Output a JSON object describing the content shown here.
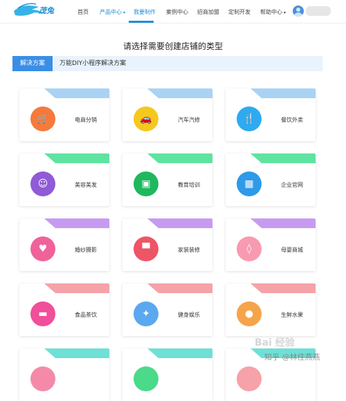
{
  "nav": {
    "logo_text": "茂兔",
    "items": [
      {
        "label": "首页"
      },
      {
        "label": "产品中心",
        "caret": "▾"
      },
      {
        "label": "我要制作"
      },
      {
        "label": "案例中心"
      },
      {
        "label": "招商加盟"
      },
      {
        "label": "定制开发"
      },
      {
        "label": "帮助中心",
        "caret": "▾"
      }
    ]
  },
  "page": {
    "title": "请选择需要创建店铺的类型",
    "tab_active": "解决方案",
    "tab_other": "万能DIY小程序解决方案"
  },
  "cards": [
    {
      "label": "电商分销",
      "icon": "shopping-cart-icon",
      "glyph": "🛒",
      "color": "#f57a3b",
      "ribbon": "#a9d2f5"
    },
    {
      "label": "汽车汽修",
      "icon": "car-icon",
      "glyph": "🚗",
      "color": "#f5c81e",
      "ribbon": "#a9d2f5"
    },
    {
      "label": "餐饮外卖",
      "icon": "fork-knife-icon",
      "glyph": "🍴",
      "color": "#2eaaf0",
      "ribbon": "#a9d2f5"
    },
    {
      "label": "美容美发",
      "icon": "beauty-face-icon",
      "glyph": "☺",
      "color": "#8f5bd6",
      "ribbon": "#5fe3a0"
    },
    {
      "label": "教育培训",
      "icon": "blackboard-icon",
      "glyph": "▣",
      "color": "#1fb85e",
      "ribbon": "#5fe3a0"
    },
    {
      "label": "企业官网",
      "icon": "building-icon",
      "glyph": "▦",
      "color": "#2e9ae8",
      "ribbon": "#5fe3a0"
    },
    {
      "label": "婚纱摄影",
      "icon": "wedding-couple-icon",
      "glyph": "♥",
      "color": "#f0629a",
      "ribbon": "#c79af2"
    },
    {
      "label": "家装装修",
      "icon": "paint-roller-icon",
      "glyph": "▀",
      "color": "#ee5566",
      "ribbon": "#c79af2"
    },
    {
      "label": "母婴商城",
      "icon": "baby-bottle-icon",
      "glyph": "◊",
      "color": "#f89ab0",
      "ribbon": "#c79af2"
    },
    {
      "label": "食品茶饮",
      "icon": "food-icon",
      "glyph": "▬",
      "color": "#f04f9a",
      "ribbon": "#f5a2a8"
    },
    {
      "label": "健身娱乐",
      "icon": "dumbbell-icon",
      "glyph": "✦",
      "color": "#5aa8f0",
      "ribbon": "#f5a2a8"
    },
    {
      "label": "生鲜水果",
      "icon": "fruit-icon",
      "glyph": "●",
      "color": "#f5a44a",
      "ribbon": "#f5a2a8"
    }
  ],
  "partial_cards": [
    {
      "ribbon": "#6fe0d6",
      "color": "#f58aa8"
    },
    {
      "ribbon": "#6fe0d6",
      "color": "#4bd98a"
    },
    {
      "ribbon": "#6fe0d6",
      "color": "#f5a2a8"
    }
  ],
  "watermark": {
    "line1": "Bai 经验",
    "line2": "知乎 @林佳燕燕"
  }
}
